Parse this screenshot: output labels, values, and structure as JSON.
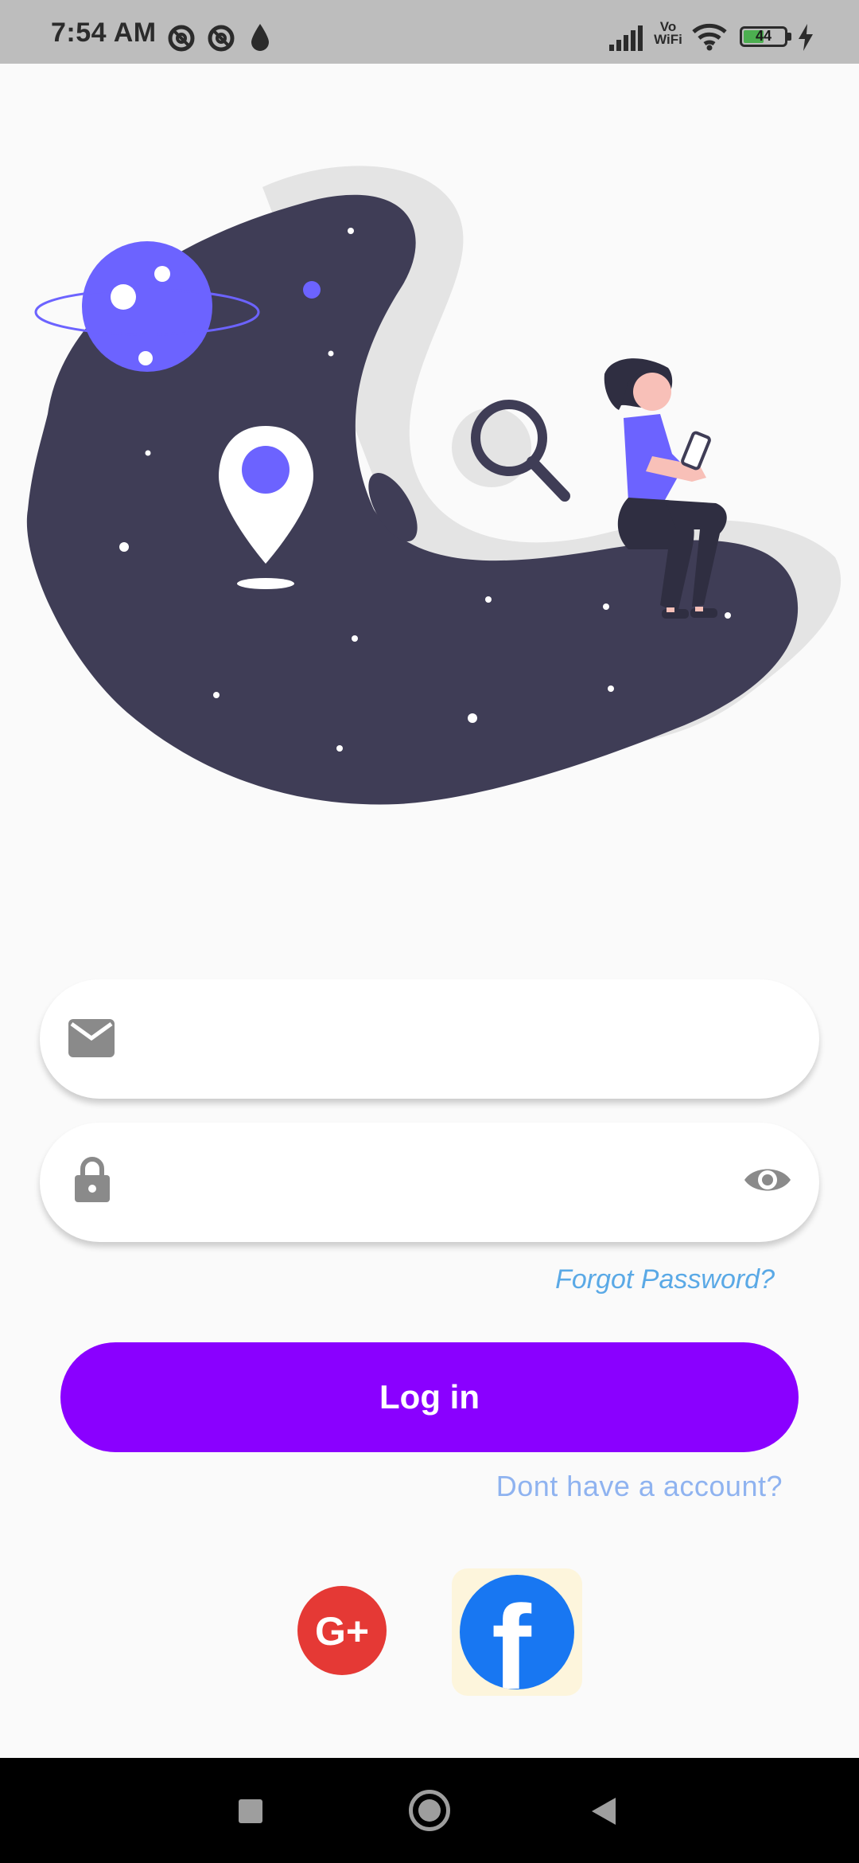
{
  "status_bar": {
    "time": "7:54 AM",
    "battery": "44",
    "icons": [
      "do-not-disturb-icon",
      "do-not-disturb-icon",
      "water-drop-icon",
      "signal-icon",
      "vowifi-icon",
      "wifi-icon",
      "battery-icon",
      "charging-icon"
    ],
    "vowifi_top": "Vo",
    "vowifi_bottom": "WiFi"
  },
  "login_form": {
    "email_placeholder": "",
    "password_placeholder": "",
    "email_icon": "mail-icon",
    "password_icon": "lock-icon",
    "visibility_icon": "eye-icon",
    "forgot_password": "Forgot Password?",
    "login_label": "Log in",
    "signup_prompt": "Dont have a account?"
  },
  "social": {
    "google_icon": "google-plus-icon",
    "google_label": "G+",
    "facebook_icon": "facebook-icon",
    "facebook_label": "f"
  },
  "colors": {
    "primary": "#8a00ff",
    "link": "#5aa9e6",
    "secondary_link": "#8fb3f0",
    "illustration_dark": "#3f3d56",
    "illustration_accent": "#6c63ff"
  },
  "nav_bar": {
    "icons": [
      "recents-square-icon",
      "home-circle-icon",
      "back-triangle-icon"
    ]
  }
}
